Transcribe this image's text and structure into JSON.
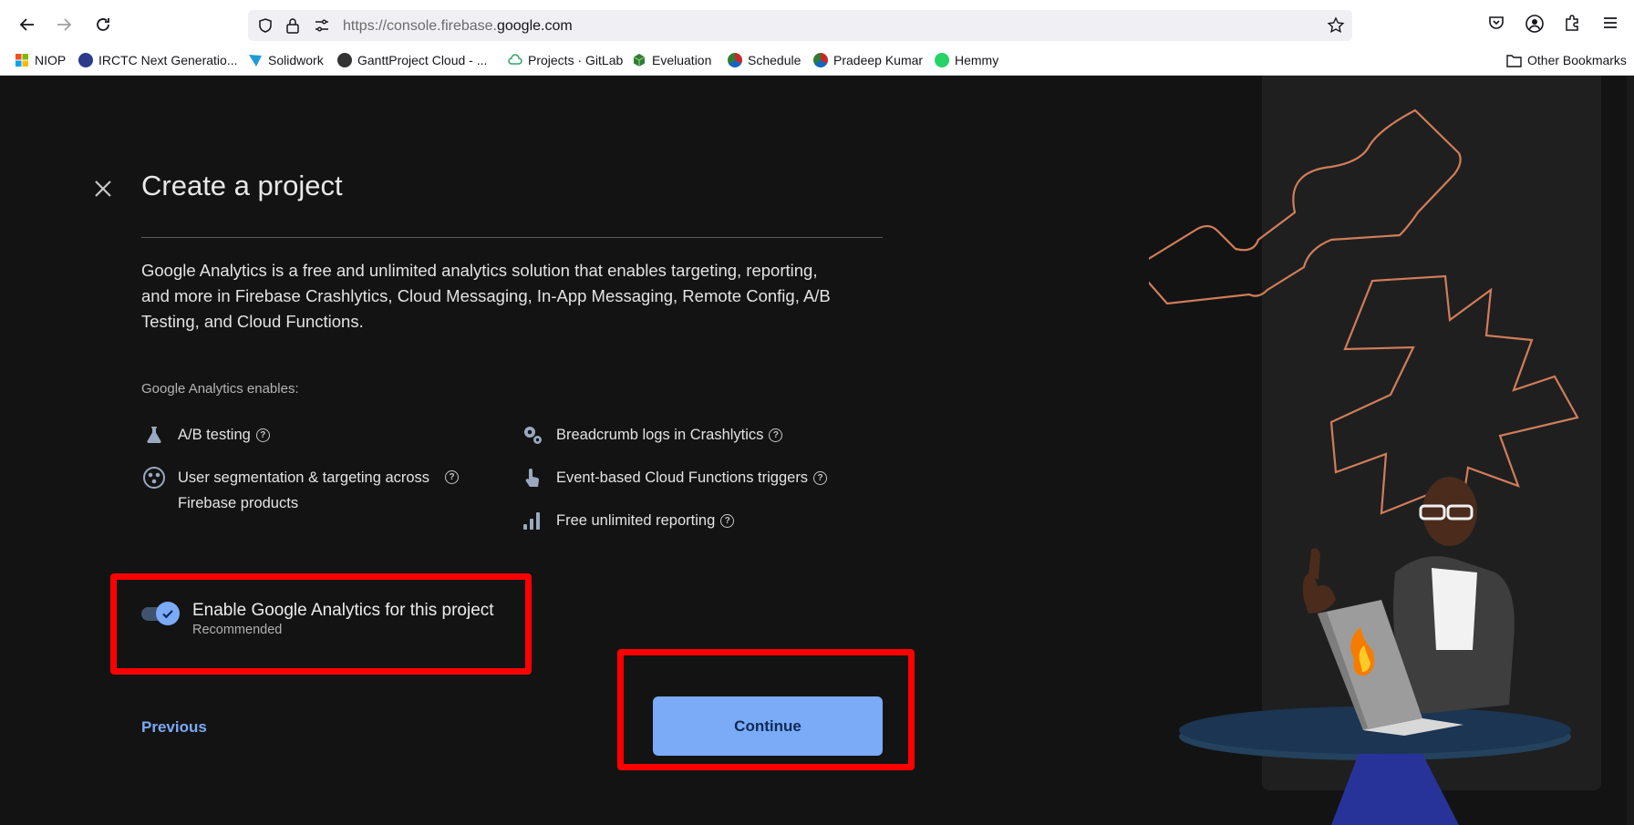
{
  "browser": {
    "url_prefix": "https://console.firebase.",
    "url_domain": "google.com",
    "bookmarks": [
      {
        "label": "NIOP",
        "color": "#f25022"
      },
      {
        "label": "IRCTC Next Generatio...",
        "color": "#2b3a8c"
      },
      {
        "label": "Solidwork",
        "color": "#1d9bd7"
      },
      {
        "label": "GanttProject Cloud - ...",
        "color": "#333333"
      },
      {
        "label": "Projects · GitLab",
        "color": "#2da06a"
      },
      {
        "label": "Eveluation",
        "color": "#2e7d32"
      },
      {
        "label": "Schedule",
        "color": "#c62828"
      },
      {
        "label": "Pradeep Kumar",
        "color": "#c62828"
      },
      {
        "label": "Hemmy",
        "color": "#25d366"
      }
    ],
    "other_bookmarks": "Other Bookmarks"
  },
  "dialog": {
    "title": "Create a project",
    "description": "Google Analytics is a free and unlimited analytics solution that enables targeting, reporting, and more in Firebase Crashlytics, Cloud Messaging, In-App Messaging, Remote Config, A/B Testing, and Cloud Functions.",
    "enables_label": "Google Analytics enables:",
    "features_left": [
      {
        "label": "A/B testing",
        "icon": "flask-icon"
      },
      {
        "label": "User segmentation & targeting across Firebase products",
        "icon": "segmentation-icon"
      }
    ],
    "features_right": [
      {
        "label": "Breadcrumb logs in Crashlytics",
        "icon": "gear-icon"
      },
      {
        "label": "Event-based Cloud Functions triggers",
        "icon": "touch-icon"
      },
      {
        "label": "Free unlimited reporting",
        "icon": "bar-chart-icon"
      }
    ],
    "toggle": {
      "label": "Enable Google Analytics for this project",
      "sublabel": "Recommended",
      "checked": true
    },
    "previous_label": "Previous",
    "continue_label": "Continue"
  },
  "colors": {
    "accent": "#7baaf7",
    "highlight": "#ff0000",
    "background": "#131313"
  }
}
